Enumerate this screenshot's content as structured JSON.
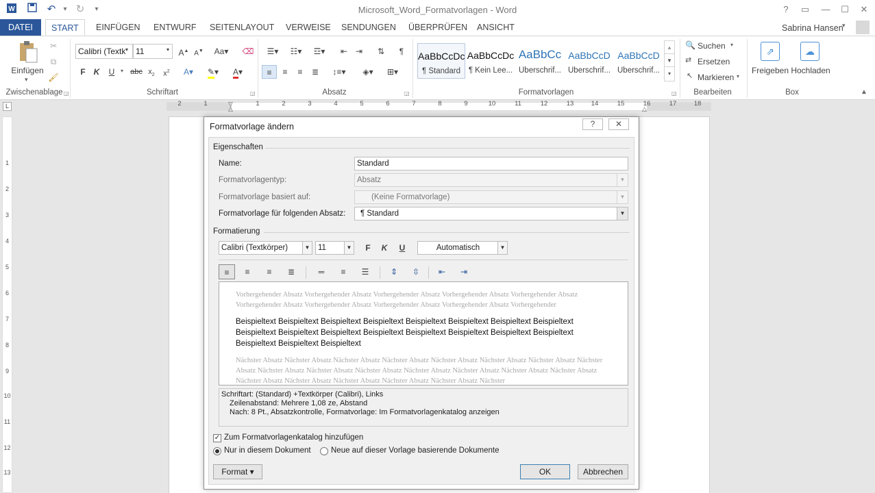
{
  "window": {
    "title": "Microsoft_Word_Formatvorlagen - Word",
    "user": "Sabrina Hansen",
    "icons": [
      "word-app-icon",
      "save-icon",
      "undo-icon",
      "redo-icon",
      "customize-qat-icon",
      "help-icon",
      "ribbon-display-icon",
      "minimize-icon",
      "maximize-icon",
      "close-icon"
    ]
  },
  "tabs": [
    "DATEI",
    "START",
    "EINFÜGEN",
    "ENTWURF",
    "SEITENLAYOUT",
    "VERWEISE",
    "SENDUNGEN",
    "ÜBERPRÜFEN",
    "ANSICHT"
  ],
  "ribbon": {
    "clipboard": {
      "paste": "Einfügen",
      "label": "Zwischenablage"
    },
    "font": {
      "name": "Calibri (Textk",
      "size": "11",
      "label": "Schriftart"
    },
    "paragraph": {
      "label": "Absatz"
    },
    "styles": {
      "label": "Formatvorlagen",
      "items": [
        {
          "preview": "AaBbCcDc",
          "name": "¶ Standard"
        },
        {
          "preview": "AaBbCcDc",
          "name": "¶ Kein Lee..."
        },
        {
          "preview": "AaBbCc",
          "name": "Überschrif..."
        },
        {
          "preview": "AaBbCcD",
          "name": "Überschrif..."
        },
        {
          "preview": "AaBbCcD",
          "name": "Überschrif..."
        }
      ]
    },
    "editing": {
      "search": "Suchen",
      "replace": "Ersetzen",
      "select": "Markieren",
      "label": "Bearbeiten"
    },
    "box": {
      "share": "Freigeben",
      "upload": "Hochladen",
      "label": "Box"
    }
  },
  "ruler": {
    "numbers": [
      "2",
      "1",
      "1",
      "2",
      "3",
      "4",
      "5",
      "6",
      "7",
      "8",
      "9",
      "10",
      "11",
      "12",
      "13",
      "14",
      "15",
      "16",
      "17",
      "18"
    ],
    "vnumbers": [
      "1",
      "2",
      "3",
      "4",
      "5",
      "6",
      "7",
      "8",
      "9",
      "10",
      "11",
      "12",
      "13"
    ]
  },
  "dialog": {
    "title": "Formatvorlage ändern",
    "help": "?",
    "close": "✕",
    "properties": {
      "heading": "Eigenschaften",
      "name_label": "Name:",
      "name_value": "Standard",
      "type_label": "Formatvorlagentyp:",
      "type_value": "Absatz",
      "based_label": "Formatvorlage basiert auf:",
      "based_value": "(Keine Formatvorlage)",
      "next_label": "Formatvorlage für folgenden Absatz:",
      "next_value": "¶  Standard"
    },
    "formatting": {
      "heading": "Formatierung",
      "font": "Calibri (Textkörper)",
      "size": "11",
      "bold": "F",
      "italic": "K",
      "underline": "U",
      "color": "Automatisch"
    },
    "preview": {
      "previous": "Vorhergehender Absatz Vorhergehender Absatz Vorhergehender Absatz Vorhergehender Absatz Vorhergehender Absatz Vorhergehender Absatz Vorhergehender Absatz Vorhergehender Absatz Vorhergehender Absatz Vorhergehender",
      "sample": "Beispieltext Beispieltext Beispieltext Beispieltext Beispieltext Beispieltext Beispieltext Beispieltext Beispieltext Beispieltext Beispieltext Beispieltext Beispieltext Beispieltext Beispieltext Beispieltext Beispieltext Beispieltext Beispieltext",
      "next": "Nächster Absatz Nächster Absatz Nächster Absatz Nächster Absatz Nächster Absatz Nächster Absatz Nächster Absatz Nächster Absatz Nächster Absatz Nächster Absatz Nächster Absatz Nächster Absatz Nächster Absatz Nächster Absatz Nächster Absatz Nächster Absatz Nächster Absatz Nächster Absatz Nächster Absatz Nächster Absatz Nächster"
    },
    "description": {
      "line1": "Schriftart: (Standard) +Textkörper (Calibri), Links",
      "line2": "Zeilenabstand:  Mehrere 1,08 ze, Abstand",
      "line3": "Nach:  8 Pt., Absatzkontrolle, Formatvorlage: Im Formatvorlagenkatalog anzeigen"
    },
    "options": {
      "add_to_gallery": "Zum Formatvorlagenkatalog hinzufügen",
      "only_this_doc": "Nur in diesem Dokument",
      "new_docs": "Neue auf dieser Vorlage basierende Dokumente"
    },
    "buttons": {
      "format": "Format ▾",
      "ok": "OK",
      "cancel": "Abbrechen"
    }
  }
}
